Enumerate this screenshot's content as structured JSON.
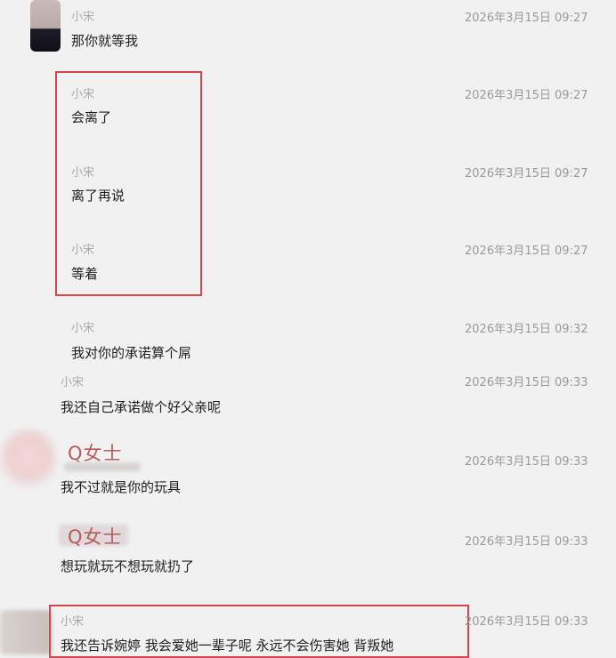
{
  "messages": [
    {
      "sender": "小宋",
      "time": "2026年3月15日 09:27",
      "text": "那你就等我"
    },
    {
      "sender": "小宋",
      "time": "2026年3月15日 09:27",
      "text": "会离了"
    },
    {
      "sender": "小宋",
      "time": "2026年3月15日 09:27",
      "text": "离了再说"
    },
    {
      "sender": "小宋",
      "time": "2026年3月15日 09:27",
      "text": "等着"
    },
    {
      "sender": "小宋",
      "time": "2026年3月15日 09:32",
      "text": "我对你的承诺算个屌"
    },
    {
      "sender": "小宋",
      "time": "2026年3月15日 09:33",
      "text": "我还自己承诺做个好父亲呢"
    },
    {
      "sender": "Q女士",
      "time": "2026年3月15日 09:33",
      "text": "我不过就是你的玩具"
    },
    {
      "sender": "Q女士",
      "time": "2026年3月15日 09:33",
      "text": "想玩就玩不想玩就扔了"
    },
    {
      "sender": "小宋",
      "time": "2026年3月15日 09:33",
      "text": "我还告诉婉婷 我会爱她一辈子呢 永远不会伤害她 背叛她"
    }
  ]
}
